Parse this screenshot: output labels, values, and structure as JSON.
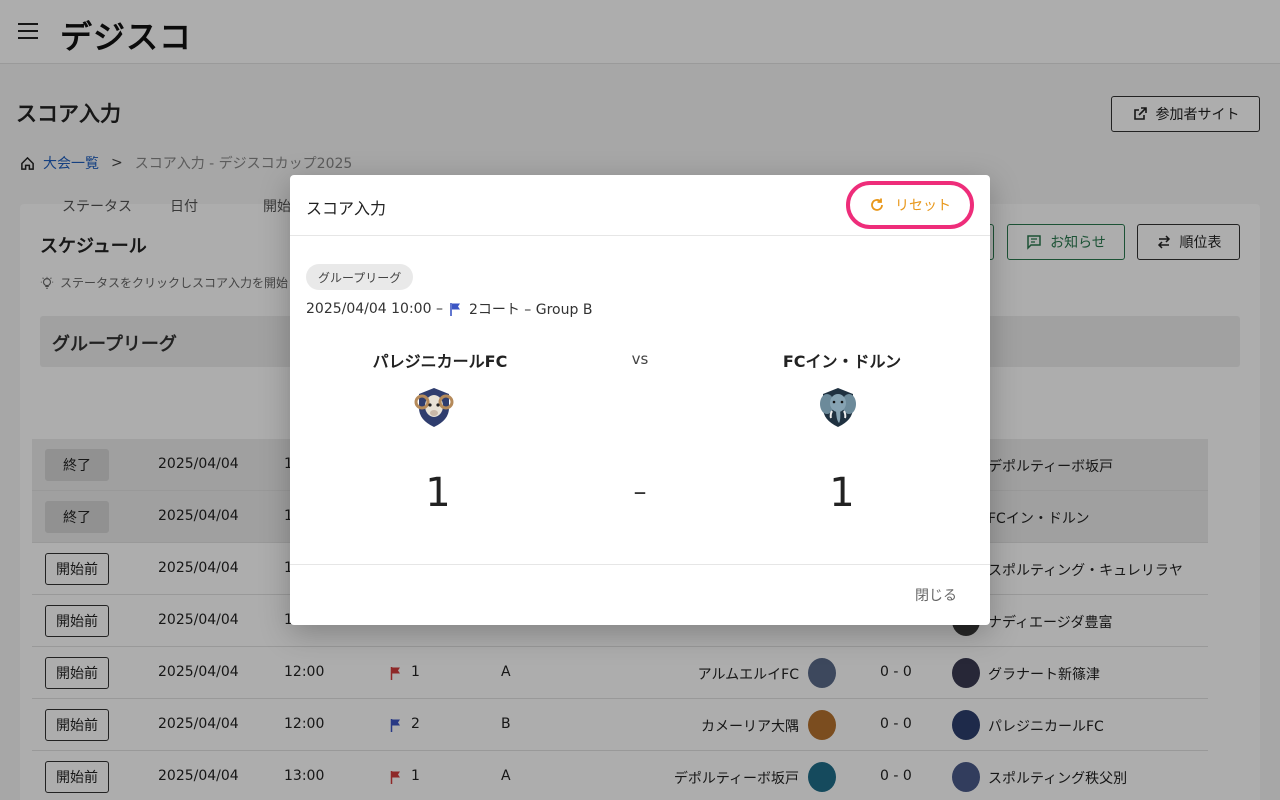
{
  "app": {
    "logo": "デジスコ"
  },
  "page": {
    "title": "スコア入力",
    "participant_site_label": "参加者サイト"
  },
  "breadcrumb": {
    "home": "大会一覧",
    "separator": ">",
    "current": "スコア入力 - デジスコカップ2025"
  },
  "schedule": {
    "title": "スケジュール",
    "hint": "ステータスをクリックしスコア入力を開始",
    "news_label": "お知らせ",
    "ranking_label": "順位表",
    "group_title": "グループリーグ",
    "columns": [
      "ステータス",
      "日付",
      "開始"
    ],
    "rows": [
      {
        "status": "終了",
        "date": "2025/04/04",
        "time": "1",
        "court": "",
        "group": "",
        "home": "",
        "score": "",
        "away": "デポルティーボ坂戸",
        "flag_color": "",
        "done": true
      },
      {
        "status": "終了",
        "date": "2025/04/04",
        "time": "1",
        "court": "",
        "group": "",
        "home": "",
        "score": "",
        "away": "FCイン・ドルン",
        "flag_color": "",
        "done": true
      },
      {
        "status": "開始前",
        "date": "2025/04/04",
        "time": "1",
        "court": "",
        "group": "",
        "home": "",
        "score": "",
        "away": "スポルティング・キュレリラヤ",
        "flag_color": "",
        "done": false
      },
      {
        "status": "開始前",
        "date": "2025/04/04",
        "time": "1",
        "court": "",
        "group": "",
        "home": "",
        "score": "",
        "away": "ナディエージダ豊富",
        "flag_color": "",
        "done": false
      },
      {
        "status": "開始前",
        "date": "2025/04/04",
        "time": "12:00",
        "court": "1",
        "group": "A",
        "home": "アルムエルイFC",
        "score": "0 - 0",
        "away": "グラナート新篠津",
        "flag_color": "#d23b3b",
        "done": false
      },
      {
        "status": "開始前",
        "date": "2025/04/04",
        "time": "12:00",
        "court": "2",
        "group": "B",
        "home": "カメーリア大隅",
        "score": "0 - 0",
        "away": "パレジニカールFC",
        "flag_color": "#3b55c4",
        "done": false
      },
      {
        "status": "開始前",
        "date": "2025/04/04",
        "time": "13:00",
        "court": "1",
        "group": "A",
        "home": "デポルティーボ坂戸",
        "score": "0 - 0",
        "away": "スポルティング秩父別",
        "flag_color": "#d23b3b",
        "done": false
      }
    ]
  },
  "modal": {
    "title": "スコア入力",
    "reset_label": "リセット",
    "chip": "グループリーグ",
    "match_datetime": "2025/04/04 10:00 –",
    "match_place": "2コート – Group B",
    "vs": "vs",
    "home_team": "パレジニカールFC",
    "away_team": "FCイン・ドルン",
    "home_score": "1",
    "away_score": "1",
    "dash": "–",
    "close_label": "閉じる",
    "flag_color": "#3b55c4"
  }
}
